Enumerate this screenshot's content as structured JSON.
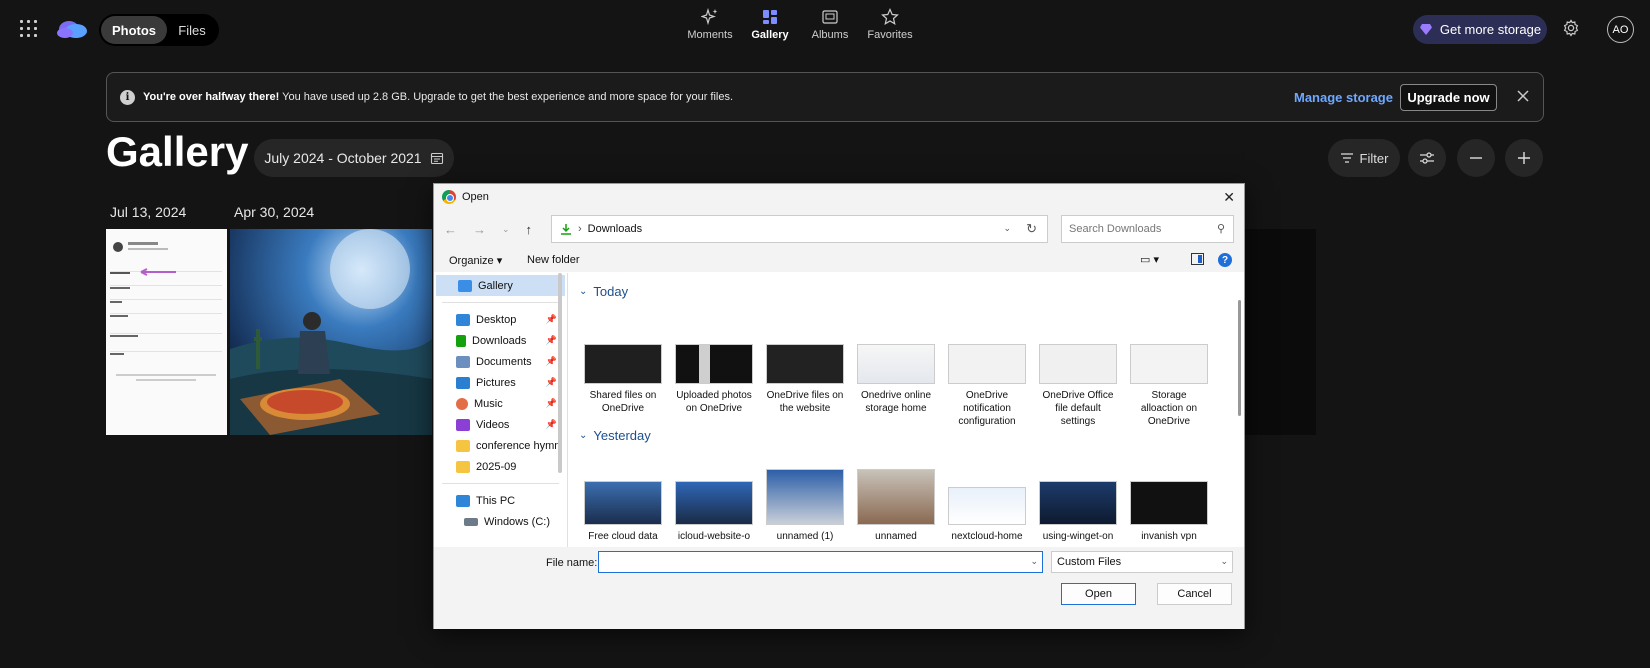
{
  "topbar": {
    "segments": [
      "Photos",
      "Files"
    ],
    "nav": [
      {
        "label": "Moments",
        "icon": "sparkle-icon"
      },
      {
        "label": "Gallery",
        "icon": "gallery-icon"
      },
      {
        "label": "Albums",
        "icon": "album-icon"
      },
      {
        "label": "Favorites",
        "icon": "star-icon"
      }
    ],
    "storage_label": "Get more storage",
    "avatar_initials": "AO"
  },
  "banner": {
    "bold": "You're over halfway there!",
    "text": " You have used up 2.8 GB. Upgrade to get the best experience and more space for your files.",
    "manage": "Manage storage",
    "upgrade": "Upgrade now"
  },
  "gallery": {
    "title": "Gallery",
    "date_range": "July 2024 - October 2021",
    "filter_label": "Filter",
    "dates": [
      "Jul 13, 2024",
      "Apr 30, 2024"
    ]
  },
  "dialog": {
    "title": "Open",
    "breadcrumb": "Downloads",
    "search_placeholder": "Search Downloads",
    "organize": "Organize",
    "new_folder": "New folder",
    "sidebar": {
      "gallery": "Gallery",
      "quick": [
        "Desktop",
        "Downloads",
        "Documents",
        "Pictures",
        "Music",
        "Videos"
      ],
      "folders": [
        "conference hymn",
        "2025-09"
      ],
      "this_pc": "This PC",
      "drive": "Windows (C:)"
    },
    "groups": {
      "today": "Today",
      "yesterday": "Yesterday"
    },
    "today_files": [
      "Shared files on OneDrive",
      "Uploaded photos on OneDrive",
      "OneDrive files on the website",
      "Onedrive online storage home",
      "OneDrive notification configuration",
      "OneDrive Office file default settings",
      "Storage alloaction on OneDrive"
    ],
    "yesterday_files": [
      "Free cloud data",
      "icloud-website-o",
      "unnamed (1)",
      "unnamed",
      "nextcloud-home",
      "using-winget-on",
      "invanish vpn"
    ],
    "file_name_label": "File name:",
    "file_name_value": "",
    "file_type": "Custom Files",
    "open": "Open",
    "cancel": "Cancel"
  }
}
